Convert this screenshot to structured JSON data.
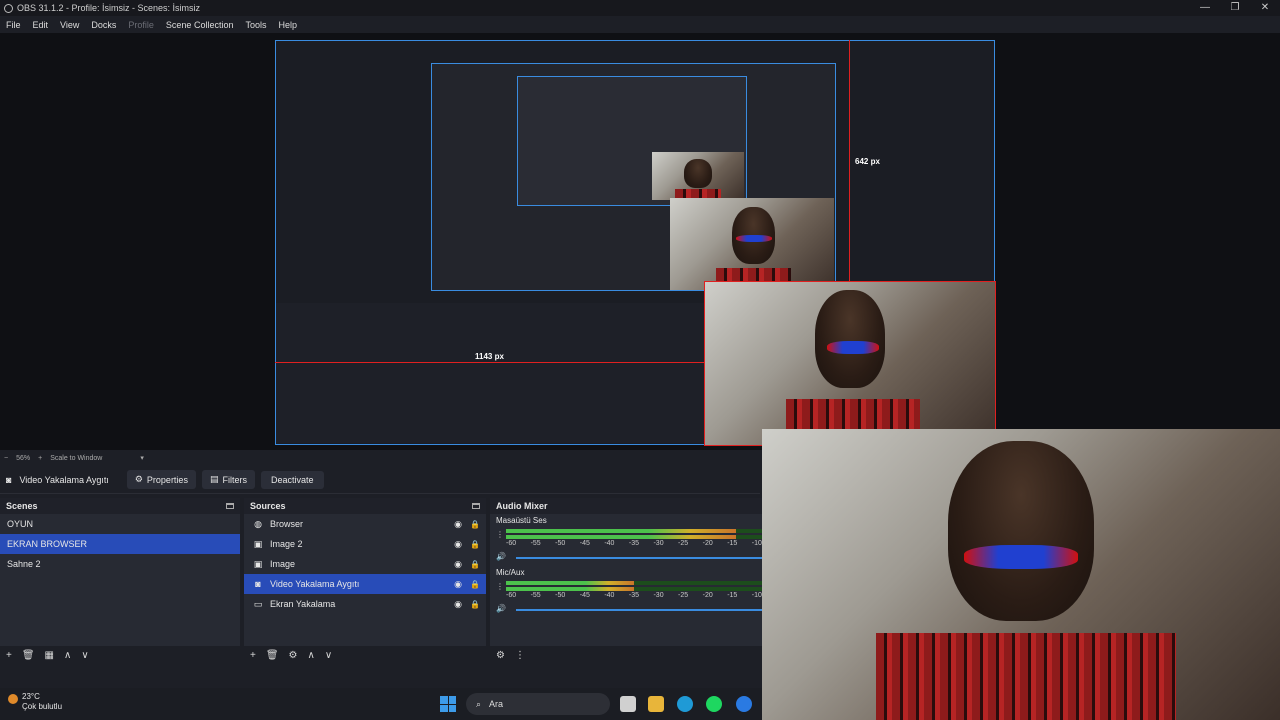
{
  "window": {
    "title": "OBS 31.1.2 - Profile: İsimsiz - Scenes: İsimsiz",
    "controls": [
      "—",
      "❐",
      "✕"
    ]
  },
  "menu": [
    "File",
    "Edit",
    "View",
    "Docks",
    "Profile",
    "Scene Collection",
    "Tools",
    "Help"
  ],
  "preview": {
    "measure_vertical": "642 px",
    "measure_horizontal": "1143 px"
  },
  "scale_bar": {
    "zoom_out": "−",
    "zoom": "56%",
    "zoom_in": "+",
    "mode": "Scale to Window"
  },
  "context": {
    "source_name": "Video Yakalama Aygıtı",
    "properties": "Properties",
    "filters": "Filters",
    "deactivate": "Deactivate"
  },
  "scenes": {
    "title": "Scenes",
    "items": [
      "OYUN",
      "EKRAN BROWSER",
      "Sahne 2"
    ],
    "selected": "EKRAN BROWSER"
  },
  "sources": {
    "title": "Sources",
    "items": [
      {
        "name": "Browser",
        "icon": "globe-icon"
      },
      {
        "name": "Image 2",
        "icon": "image-icon"
      },
      {
        "name": "Image",
        "icon": "image-icon"
      },
      {
        "name": "Video Yakalama Aygıtı",
        "icon": "camera-icon"
      },
      {
        "name": "Ekran Yakalama",
        "icon": "monitor-icon"
      }
    ],
    "selected": "Video Yakalama Aygıtı"
  },
  "mixer": {
    "title": "Audio Mixer",
    "channels": [
      {
        "name": "Masaüstü Ses",
        "level": 0.9
      },
      {
        "name": "Mic/Aux",
        "level": 0.5
      }
    ],
    "ticks": [
      "-60",
      "-55",
      "-50",
      "-45",
      "-40",
      "-35",
      "-30",
      "-25",
      "-20",
      "-15",
      "-10"
    ]
  },
  "taskbar": {
    "temperature": "23°C",
    "weather": "Çok bulutlu",
    "search_label": "Ara"
  },
  "colors": {
    "accent": "#284cb8",
    "selection_red": "#e02020",
    "preview_blue": "#3a8ce0"
  }
}
